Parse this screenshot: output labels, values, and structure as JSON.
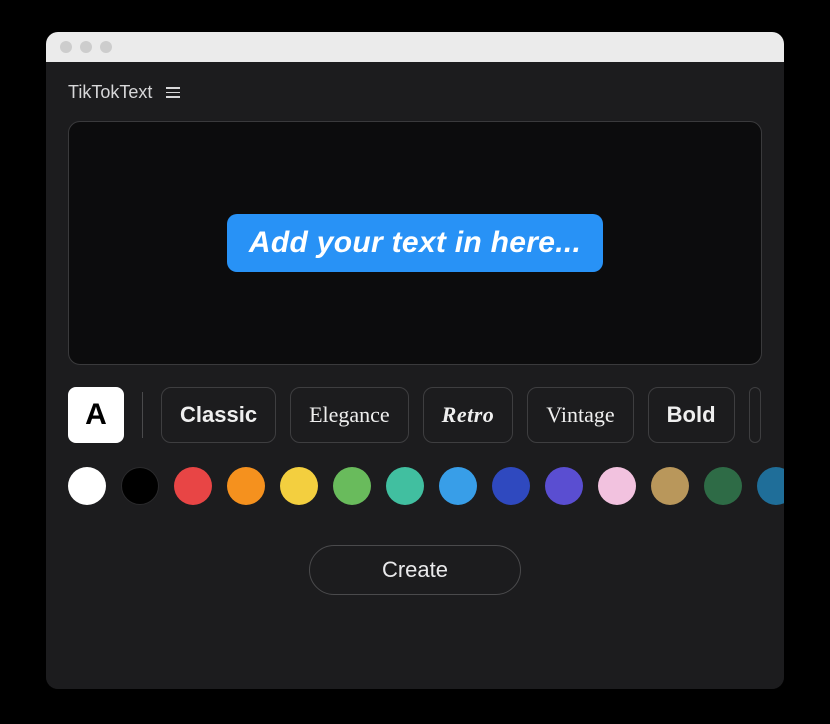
{
  "app": {
    "title": "TikTokText"
  },
  "canvas": {
    "text": "Add your text in here..."
  },
  "letter_tile": "A",
  "styles": [
    {
      "id": "classic",
      "label": "Classic",
      "css": "sf-classic"
    },
    {
      "id": "elegance",
      "label": "Elegance",
      "css": "sf-elegance"
    },
    {
      "id": "retro",
      "label": "Retro",
      "css": "sf-retro"
    },
    {
      "id": "vintage",
      "label": "Vintage",
      "css": "sf-vintage"
    },
    {
      "id": "bold",
      "label": "Bold",
      "css": "sf-bold"
    }
  ],
  "colors": [
    "#ffffff",
    "#000000",
    "#e84545",
    "#f5911e",
    "#f3cf3f",
    "#69bb5c",
    "#41bfa0",
    "#389ee8",
    "#2f49bf",
    "#5a4ed1",
    "#f2c2df",
    "#b9975b",
    "#2e6b46",
    "#1f6e99"
  ],
  "create_label": "Create"
}
